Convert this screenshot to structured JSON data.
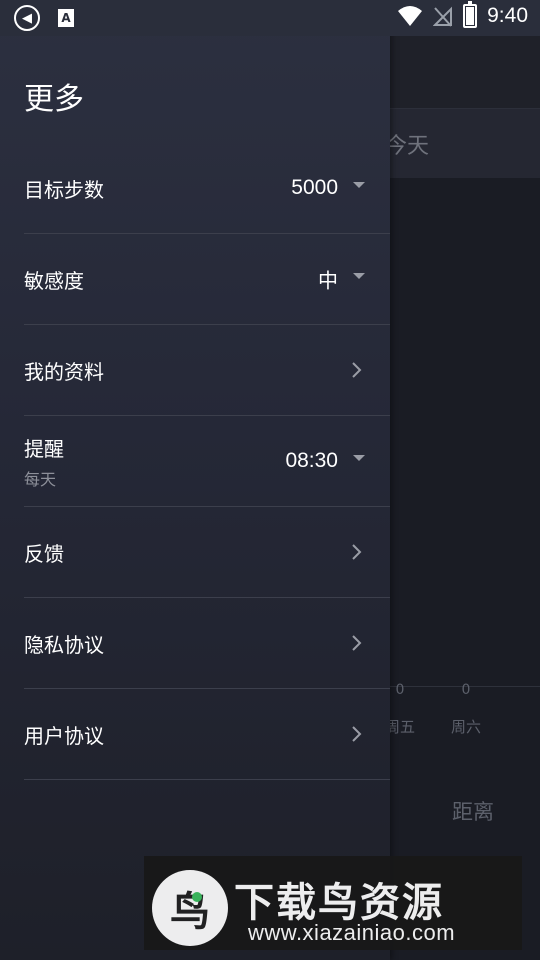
{
  "status_bar": {
    "time": "9:40",
    "left_icons": [
      "navigation-icon",
      "font-a-icon"
    ],
    "right_icons": [
      "wifi-icon",
      "no-signal-icon",
      "battery-charging-icon"
    ]
  },
  "background": {
    "tab_today": "今天",
    "chart": {
      "values": [
        "0",
        "0"
      ],
      "days": [
        "周五",
        "周六"
      ]
    },
    "distance_label": "距离"
  },
  "drawer": {
    "title": "更多",
    "items": [
      {
        "label": "目标步数",
        "value": "5000",
        "control": "dropdown"
      },
      {
        "label": "敏感度",
        "value": "中",
        "control": "dropdown"
      },
      {
        "label": "我的资料",
        "control": "chevron"
      },
      {
        "label": "提醒",
        "sublabel": "每天",
        "value": "08:30",
        "control": "dropdown"
      },
      {
        "label": "反馈",
        "control": "chevron"
      },
      {
        "label": "隐私协议",
        "control": "chevron"
      },
      {
        "label": "用户协议",
        "control": "chevron"
      }
    ]
  },
  "watermark": {
    "title": "下载鸟资源",
    "url": "www.xiazainiao.com"
  },
  "colors": {
    "drawer_top": "#2c3040",
    "drawer_bottom": "#1e2029",
    "divider": "#3c3f4c",
    "secondary_text": "#8d909a"
  }
}
